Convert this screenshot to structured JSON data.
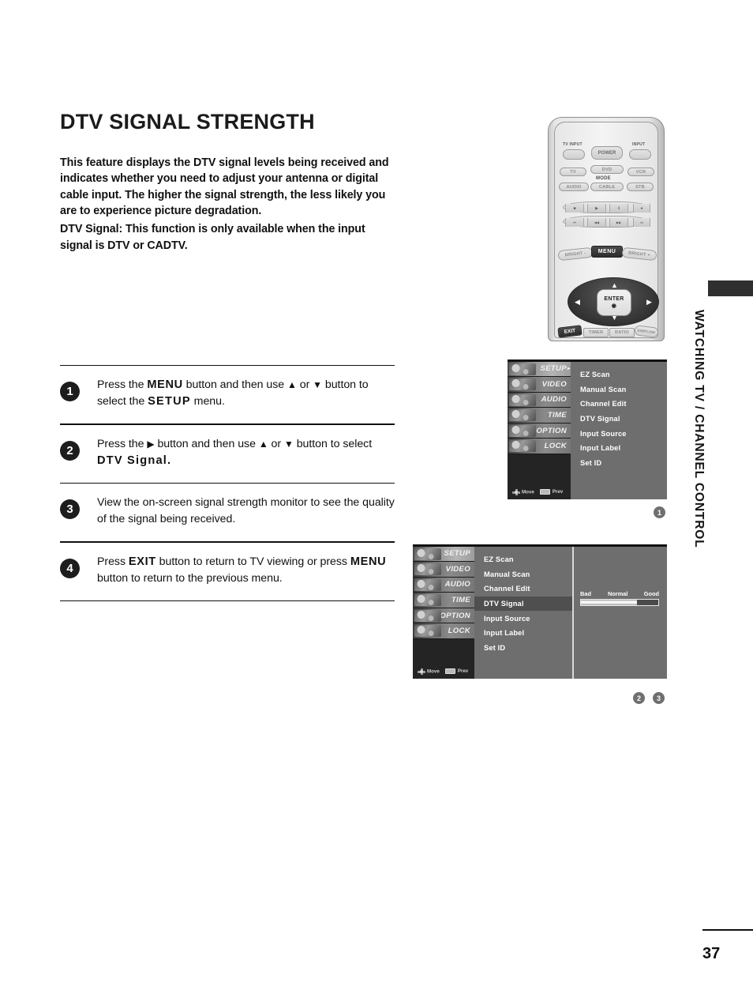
{
  "page": {
    "title": "DTV SIGNAL STRENGTH",
    "number": "37",
    "side_tab": "WATCHING TV / CHANNEL CONTROL"
  },
  "intro": {
    "paragraph1": "This feature displays the DTV signal levels being received and indicates whether you need to adjust your antenna or digital cable input. The higher the signal strength, the less likely you are to experience picture degradation.",
    "paragraph2": "DTV Signal: This function is only available when the input signal is DTV or CADTV."
  },
  "steps": [
    {
      "num": "1",
      "parts": [
        "Press the ",
        "MENU",
        " button and then use ",
        "▲",
        " or ",
        "▼",
        " button to select the ",
        "SETUP",
        " menu."
      ]
    },
    {
      "num": "2",
      "parts": [
        "Press the ",
        "▶",
        " button and then use ",
        "▲",
        " or ",
        "▼",
        " button to select ",
        "DTV Signal",
        "."
      ]
    },
    {
      "num": "3",
      "parts": [
        "View the on-screen signal strength monitor to see the quality of the signal being received."
      ]
    },
    {
      "num": "4",
      "parts": [
        "Press ",
        "EXIT",
        " button to return to TV viewing or press ",
        "MENU",
        " button to return to the previous menu."
      ]
    }
  ],
  "remote": {
    "labels": {
      "tv_input": "TV INPUT",
      "power": "POWER",
      "input": "INPUT",
      "mode": "MODE",
      "tv": "TV",
      "dvd": "DVD",
      "vcr": "VCR",
      "audio": "AUDIO",
      "cable": "CABLE",
      "stb": "STB",
      "bright_minus": "BRIGHT -",
      "menu": "MENU",
      "bright_plus": "BRIGHT +",
      "enter": "ENTER",
      "exit": "EXIT",
      "timer": "TIMER",
      "ratio": "RATIO",
      "simplink": "SIMPLINK"
    },
    "transport_row1": [
      "■",
      "▶",
      "Ⅱ",
      "●"
    ],
    "transport_row2": [
      "⏮",
      "◀◀",
      "▶▶",
      "⏭"
    ],
    "dpad": {
      "up": "▲",
      "down": "▼",
      "left": "◀",
      "right": "▶",
      "enter_dot": "◉"
    },
    "highlighted": [
      "MENU",
      "EXIT"
    ]
  },
  "osd": {
    "sidebar_items": [
      "SETUP",
      "VIDEO",
      "AUDIO",
      "TIME",
      "OPTION",
      "LOCK"
    ],
    "menu_items": [
      "EZ Scan",
      "Manual Scan",
      "Channel Edit",
      "DTV Signal",
      "Input Source",
      "Input Label",
      "Set ID"
    ],
    "hints": {
      "move": "Move",
      "prev": "Prev"
    },
    "screen1": {
      "selected_sidebar": "SETUP",
      "selected_menu": null,
      "badge": "1"
    },
    "screen2": {
      "selected_sidebar": "SETUP",
      "selected_menu": "DTV Signal",
      "badges": [
        "2",
        "3"
      ],
      "signal": {
        "labels": [
          "Bad",
          "Normal",
          "Good"
        ],
        "fill_percent": 72
      }
    }
  },
  "colors": {
    "osd_background": "#6e6e6e",
    "osd_selected": "#4f6e6e",
    "badge_dark": "#1d1d1d",
    "badge_gray": "#6f6f6f",
    "side_tab_bar": "#2f2f2f"
  }
}
